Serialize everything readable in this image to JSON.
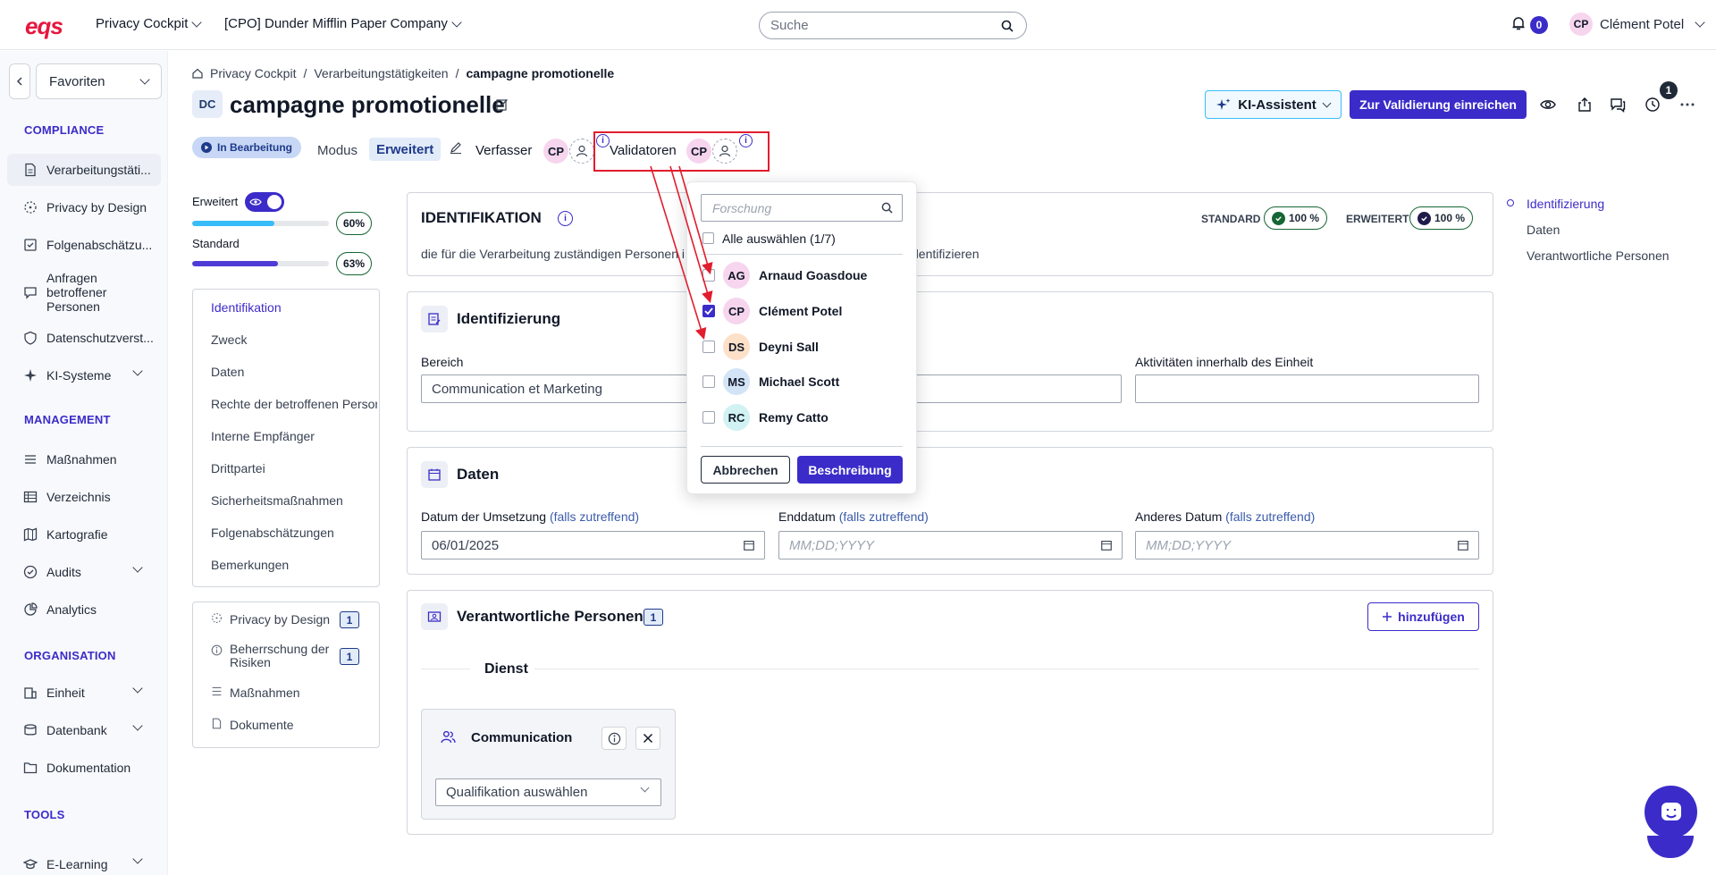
{
  "topbar": {
    "logo": "eqs",
    "app_menu": "Privacy Cockpit",
    "company_menu": "[CPO] Dunder Mifflin Paper Company",
    "search_placeholder": "Suche",
    "notifications": "0",
    "user_initials": "CP",
    "user_name": "Clément Potel"
  },
  "sidebar": {
    "favorites": "Favoriten",
    "sections": {
      "compliance": "COMPLIANCE",
      "management": "MANAGEMENT",
      "organisation": "ORGANISATION",
      "tools": "TOOLS"
    },
    "items": [
      {
        "label": "Verarbeitungstäti...",
        "icon": "document-icon"
      },
      {
        "label": "Privacy by Design",
        "icon": "dashed-circle-icon"
      },
      {
        "label": "Folgenabschätzu...",
        "icon": "folder-check-icon"
      },
      {
        "label": "Anfragen betroffener Personen",
        "icon": "chat-icon"
      },
      {
        "label": "Datenschutzverst...",
        "icon": "shield-icon"
      },
      {
        "label": "KI-Systeme",
        "icon": "sparkle-icon"
      },
      {
        "label": "Maßnahmen",
        "icon": "list-icon"
      },
      {
        "label": "Verzeichnis",
        "icon": "table-icon"
      },
      {
        "label": "Kartografie",
        "icon": "map-icon"
      },
      {
        "label": "Audits",
        "icon": "check-circle-icon"
      },
      {
        "label": "Analytics",
        "icon": "chart-icon"
      },
      {
        "label": "Einheit",
        "icon": "building-icon"
      },
      {
        "label": "Datenbank",
        "icon": "database-icon"
      },
      {
        "label": "Dokumentation",
        "icon": "folder-icon"
      },
      {
        "label": "E-Learning",
        "icon": "graduation-icon"
      }
    ]
  },
  "header": {
    "breadcrumb": [
      "Privacy Cockpit",
      "Verarbeitungstätigkeiten",
      "campagne promotionelle"
    ],
    "badge": "DC",
    "title": "campagne promotionelle",
    "status": "In Bearbeitung",
    "modus_label": "Modus",
    "modus_value": "Erweitert",
    "verfasser_label": "Verfasser",
    "verfasser_initials": "CP",
    "validatoren_label": "Validatoren",
    "validator_initials": "CP",
    "ki_button": "KI-Assistent",
    "submit_button": "Zur Validierung einreichen",
    "history_count": "1"
  },
  "progress": {
    "erweitert_label": "Erweitert",
    "erweitert_pct": "60%",
    "erweitert_value": 0.6,
    "standard_label": "Standard",
    "standard_pct": "63%",
    "standard_value": 0.63
  },
  "section_nav": [
    "Identifikation",
    "Zweck",
    "Daten",
    "Rechte der betroffenen Personen",
    "Interne Empfänger",
    "Drittpartei",
    "Sicherheitsmaßnahmen",
    "Folgenabschätzungen",
    "Bemerkungen"
  ],
  "related": [
    {
      "label": "Privacy by Design",
      "count": "1"
    },
    {
      "label": "Beherrschung der Risiken",
      "count": "1"
    },
    {
      "label": "Maßnahmen",
      "count": ""
    },
    {
      "label": "Dokumente",
      "count": ""
    }
  ],
  "identifikation": {
    "title": "IDENTIFIKATION",
    "desc_left": "die für die Verarbeitung zuständigen Personen i",
    "desc_right": "dentifizieren",
    "standard_label": "STANDARD",
    "standard_value": "100 %",
    "erweitert_label": "ERWEITERT",
    "erweitert_value": "100 %"
  },
  "identifizierung": {
    "title": "Identifizierung",
    "bereich_label": "Bereich",
    "bereich_value": "Communication et Marketing",
    "aktiv_label": "Aktivitäten innerhalb des Einheit"
  },
  "daten": {
    "title": "Daten",
    "umsetzung_label": "Datum der Umsetzung",
    "umsetzung_hint": "(falls zutreffend)",
    "umsetzung_value": "06/01/2025",
    "end_label": "Enddatum",
    "end_hint": "(falls zutreffend)",
    "end_placeholder": "MM;DD;YYYY",
    "other_label": "Anderes Datum",
    "other_hint": "(falls zutreffend)",
    "other_placeholder": "MM;DD;YYYY"
  },
  "verantwortliche": {
    "title": "Verantwortliche Personen",
    "count": "1",
    "add_button": "hinzufügen",
    "dienst": "Dienst",
    "card_title": "Communication",
    "qual_placeholder": "Qualifikation auswählen"
  },
  "dropdown": {
    "search_placeholder": "Forschung",
    "select_all": "Alle auswählen (1/7)",
    "people": [
      {
        "initials": "AG",
        "name": "Arnaud Goasdoue",
        "checked": false,
        "color": "#f7d5ee"
      },
      {
        "initials": "CP",
        "name": "Clément Potel",
        "checked": true,
        "color": "#f7d5ee"
      },
      {
        "initials": "DS",
        "name": "Deyni Sall",
        "checked": false,
        "color": "#fde0c8"
      },
      {
        "initials": "MS",
        "name": "Michael Scott",
        "checked": false,
        "color": "#d4e4f7"
      },
      {
        "initials": "RC",
        "name": "Remy Catto",
        "checked": false,
        "color": "#d1f2f2"
      }
    ],
    "cancel": "Abbrechen",
    "confirm": "Beschreibung"
  },
  "toc": [
    "Identifizierung",
    "Daten",
    "Verantwortliche Personen"
  ],
  "colors": {
    "accent": "#3b2cc9",
    "highlight": "#e11d2e",
    "brand": "#e5173f"
  }
}
